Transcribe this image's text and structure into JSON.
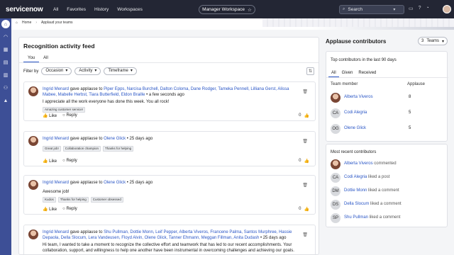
{
  "topbar": {
    "logo_text": "servicenow",
    "nav": [
      "All",
      "Favorites",
      "History",
      "Workspaces"
    ],
    "workspace_label": "Manager Workspace",
    "search_placeholder": "Search"
  },
  "breadcrumb": {
    "home": "Home",
    "current": "Applaud your teams"
  },
  "feed": {
    "title": "Recognition activity feed",
    "tabs": [
      "You",
      "All"
    ],
    "filter_label": "Filter by",
    "filters": [
      "Occasion",
      "Activity",
      "Timeframe"
    ],
    "like_label": "Like",
    "reply_label": "Reply",
    "cards": [
      {
        "author": "Ingrid Menard",
        "verb": "gave applause to",
        "recipients": "Piper Epps, Narcisa Burchell, Dalton Coloma, Dane Rodger, Tameka Pennell, Lilliana Gerst, Alissa Mabee, Mabelle Herbst, Tiara Butterfield, Eldon Braille",
        "time": "a few seconds ago",
        "message": "I appreciate all the work everyone has done this week. You all rock!",
        "tags": [
          "Amazing customer service!"
        ],
        "likes": "0"
      },
      {
        "author": "Ingrid Menard",
        "verb": "gave applause to",
        "recipients": "Olene Glick",
        "time": "25 days ago",
        "message": "",
        "tags": [
          "Great job!",
          "Collaboration champion",
          "Thanks for helping"
        ],
        "likes": "0"
      },
      {
        "author": "Ingrid Menard",
        "verb": "gave applause to",
        "recipients": "Olene Glick",
        "time": "25 days ago",
        "message": "Awesome job!",
        "tags": [
          "Kudos",
          "Thanks for helping",
          "Customer obsessed"
        ],
        "likes": "0"
      },
      {
        "author": "Ingrid Menard",
        "verb": "gave applause to",
        "recipients": "Shu Pullman, Dottie Monn, Leif Pepper, Alberta Viveros, Francene Palma, Santos Murphree, Hassie Depaola, Della Slocum, Lera Vandeusen, Floyd Alvin, Olene Glick, Tanner Ehmann, Meggan Fillman, Anita Dudash",
        "time": "25 days ago",
        "message": "Hi team, I wanted to take a moment to recognize the collective effort and teamwork that has led to our recent accomplishments. Your collaboration, support, and willingness to help one another have been instrumental in overcoming challenges and achieving our goals. Thank you",
        "tags": [],
        "likes": ""
      }
    ]
  },
  "contributors": {
    "title": "Applause contributors",
    "select_count": "3",
    "select_label": "Teams",
    "top_heading": "Top contributors in the last 90 days",
    "tabs": [
      "All",
      "Given",
      "Received"
    ],
    "col_member": "Team member",
    "col_applause": "Applause",
    "top": [
      {
        "initials": "",
        "name": "Alberta Viveros",
        "value": "8"
      },
      {
        "initials": "CA",
        "name": "Codi Alegria",
        "value": "5"
      },
      {
        "initials": "OG",
        "name": "Olene Glick",
        "value": "5"
      }
    ],
    "recent_heading": "Most recent contributors",
    "recent": [
      {
        "initials": "",
        "name": "Alberta Viveros",
        "action": "commented"
      },
      {
        "initials": "CA",
        "name": "Codi Alegria",
        "action": "liked a post"
      },
      {
        "initials": "DM",
        "name": "Dottie Monn",
        "action": "liked a comment"
      },
      {
        "initials": "DS",
        "name": "Della Slocum",
        "action": "liked a comment"
      },
      {
        "initials": "SP",
        "name": "Shu Pullman",
        "action": "liked a comment"
      }
    ]
  }
}
